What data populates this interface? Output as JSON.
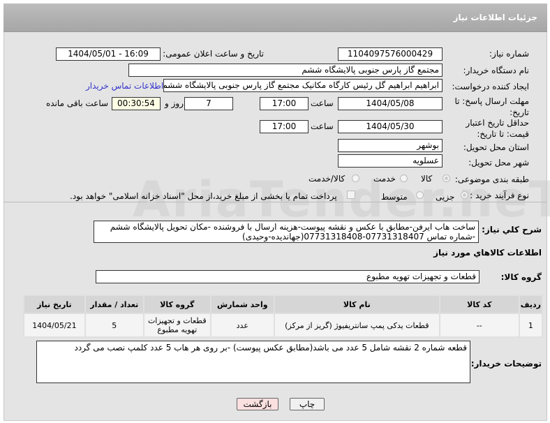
{
  "header": {
    "title": "جزئیات اطلاعات نیاز"
  },
  "fields": {
    "need_number_label": "شماره نیاز:",
    "need_number": "1104097576000429",
    "announce_label": "تاریخ و ساعت اعلان عمومی:",
    "announce_value": "1404/05/01 - 16:09",
    "buyer_label": "نام دستگاه خریدار:",
    "buyer": "مجتمع گاز پارس جنوبی  پالایشگاه ششم",
    "creator_label": "ایجاد کننده درخواست:",
    "creator": "ابراهیم ابراهیم گل رئیس کارگاه مکانیک مجتمع گاز پارس جنوبی  پالایشگاه ششم",
    "contact_link": "اطلاعات تماس خریدار",
    "deadline_label": "مهلت ارسال پاسخ: تا تاریخ:",
    "deadline_date": "1404/05/08",
    "time_label": "ساعت",
    "deadline_time": "17:00",
    "days": "7",
    "days_label": "روز و",
    "remaining": "00:30:54",
    "remaining_label": "ساعت باقی مانده",
    "validity_label": "حداقل تاریخ اعتبار قیمت: تا تاریخ:",
    "validity_date": "1404/05/30",
    "validity_time": "17:00",
    "province_label": "استان محل تحویل:",
    "province": "بوشهر",
    "city_label": "شهر محل تحویل:",
    "city": "عسلویه",
    "category_label": "طبقه بندی موضوعی:",
    "category_options": [
      "کالا",
      "خدمت",
      "کالا/خدمت"
    ],
    "category_selected": "کالا",
    "process_label": "نوع فرآیند خرید :",
    "process_options": [
      "جزیی",
      "متوسط"
    ],
    "process_selected": "جزیی",
    "payment_note": "پرداخت تمام یا بخشی از مبلغ خرید،از محل \"اسناد خزانه اسلامی\" خواهد بود.",
    "desc_label": "شرح کلي نياز:",
    "desc": "ساخت هاب ایرفن-مطابق با عکس و نقشه پیوست-هزینه ارسال با فروشنده -مکان تحویل پالایشگاه ششم -شماره تماس 07731318407-07731318408(جهاندیده-وحیدی)",
    "goods_info_title": "اطلاعات کالاهاي مورد نياز",
    "goods_group_label": "گروه کالا:",
    "goods_group": "قطعات و تجهیزات تهویه مطبوع"
  },
  "table": {
    "headers": [
      "ردیف",
      "کد کالا",
      "نام کالا",
      "واحد شمارش",
      "گروه کالا",
      "تعداد / مقدار",
      "تاریخ نیاز"
    ],
    "rows": [
      [
        "1",
        "--",
        "قطعات یدکی پمپ سانتریفیوژ (گریز از مرکز)",
        "عدد",
        "قطعات و تجهیزات تهویه مطبوع",
        "5",
        "1404/05/21"
      ]
    ]
  },
  "notes": {
    "label": "توضیحات خریدار:",
    "value": "قطعه شماره 2 نقشه شامل 5 عدد می باشد(مطابق عکس پیوست) -بر روی هر هاب 5 عدد کلمپ نصب می گردد"
  },
  "buttons": {
    "print": "چاپ",
    "back": "بازگشت"
  },
  "watermark": "AriaTender.neT"
}
